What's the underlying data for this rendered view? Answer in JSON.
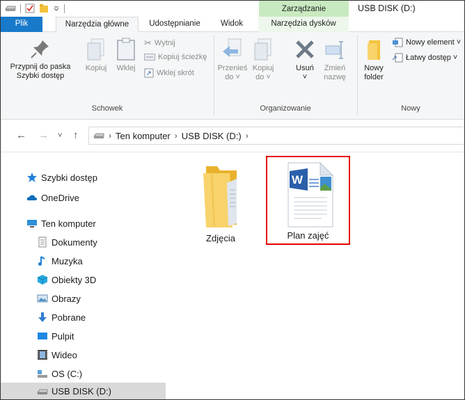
{
  "window": {
    "title": "USB DISK (D:)",
    "context_tab": "Zarządzanie"
  },
  "ribbon_tabs": [
    {
      "label": "Plik"
    },
    {
      "label": "Narzędzia główne"
    },
    {
      "label": "Udostępnianie"
    },
    {
      "label": "Widok"
    },
    {
      "label": "Narzędzia dysków"
    }
  ],
  "ribbon": {
    "clipboard": {
      "pin_label_1": "Przypnij do paska",
      "pin_label_2": "Szybki dostęp",
      "copy_label": "Kopiuj",
      "paste_label": "Wklej",
      "cut_label": "Wytnij",
      "copy_path_label": "Kopiuj ścieżkę",
      "paste_shortcut_label": "Wklej skrót",
      "group_label": "Schowek"
    },
    "organize": {
      "move_label_1": "Przenieś",
      "move_label_2": "do ˅",
      "copyto_label_1": "Kopiuj",
      "copyto_label_2": "do ˅",
      "delete_label_1": "Usuń",
      "delete_label_2": "˅",
      "rename_label_1": "Zmień",
      "rename_label_2": "nazwę",
      "group_label": "Organizowanie"
    },
    "new": {
      "new_folder_label_1": "Nowy",
      "new_folder_label_2": "folder",
      "new_item_label": "Nowy element ˅",
      "easy_access_label": "Łatwy dostęp ˅",
      "group_label": "Nowy"
    }
  },
  "address": {
    "crumbs": [
      "Ten komputer",
      "USB DISK (D:)"
    ]
  },
  "nav_items": [
    {
      "label": "Szybki dostęp",
      "icon": "star-icon",
      "color": "#1e7fd6"
    },
    {
      "label": "OneDrive",
      "icon": "cloud-icon",
      "color": "#0f6cbd"
    },
    {
      "label": "Ten komputer",
      "icon": "computer-icon",
      "color": "#2f8fd8"
    },
    {
      "label": "Dokumenty",
      "icon": "document-icon",
      "color": "#8a8a8a"
    },
    {
      "label": "Muzyka",
      "icon": "music-icon",
      "color": "#1e7fd6"
    },
    {
      "label": "Obiekty 3D",
      "icon": "cube-icon",
      "color": "#27a8e0"
    },
    {
      "label": "Obrazy",
      "icon": "image-icon",
      "color": "#4a90c8"
    },
    {
      "label": "Pobrane",
      "icon": "download-icon",
      "color": "#2f7fd0"
    },
    {
      "label": "Pulpit",
      "icon": "desktop-icon",
      "color": "#1e88e5"
    },
    {
      "label": "Wideo",
      "icon": "video-icon",
      "color": "#444444"
    },
    {
      "label": "OS (C:)",
      "icon": "drive-icon",
      "color": "#5aa0d8"
    },
    {
      "label": "USB DISK (D:)",
      "icon": "usb-drive-icon",
      "color": "#666666"
    }
  ],
  "files": [
    {
      "label": "Zdjęcia",
      "icon": "folder-icon"
    },
    {
      "label": "Plan zajęć",
      "icon": "word-document-icon"
    }
  ],
  "colors": {
    "file_tab": "#1979ca",
    "context_tab": "#c8eac0",
    "selection_outline": "#e60000"
  }
}
